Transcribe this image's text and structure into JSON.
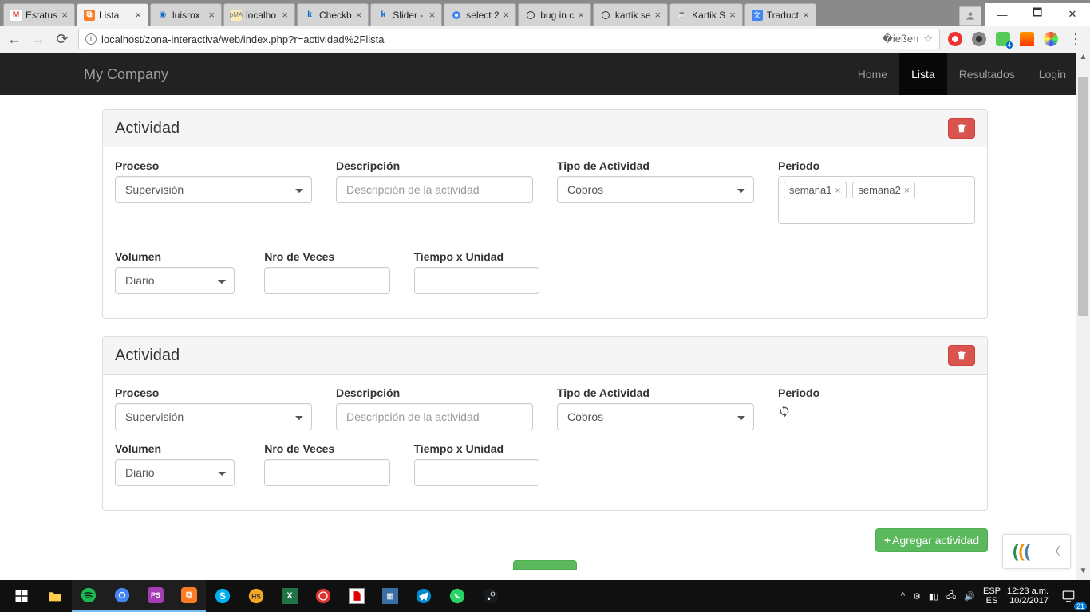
{
  "browser": {
    "tabs": [
      {
        "title": "Estatus",
        "icon_bg": "#fff",
        "icon_text": "M"
      },
      {
        "title": "Lista",
        "icon_bg": "#fb7c24",
        "icon_text": "X",
        "active": true
      },
      {
        "title": "luisrox",
        "icon_bg": "#2f2f2f",
        "icon_text": "◉"
      },
      {
        "title": "localho",
        "icon_bg": "#fceab7",
        "icon_text": "p"
      },
      {
        "title": "Checkb",
        "icon_bg": "#fff",
        "icon_text": "k"
      },
      {
        "title": "Slider -",
        "icon_bg": "#fff",
        "icon_text": "k"
      },
      {
        "title": "select 2",
        "icon_bg": "#fff",
        "icon_text": "G"
      },
      {
        "title": "bug in c",
        "icon_bg": "#fff",
        "icon_text": "○"
      },
      {
        "title": "kartik se",
        "icon_bg": "#fff",
        "icon_text": "○"
      },
      {
        "title": "Kartik S",
        "icon_bg": "#fff",
        "icon_text": "☕"
      },
      {
        "title": "Traduct",
        "icon_bg": "#4285f4",
        "icon_text": "G"
      }
    ],
    "url": "localhost/zona-interactiva/web/index.php?r=actividad%2Flista"
  },
  "navbar": {
    "brand": "My Company",
    "links": [
      "Home",
      "Lista",
      "Resultados",
      "Login"
    ],
    "active": "Lista"
  },
  "panels": [
    {
      "title": "Actividad",
      "fields": {
        "proceso_label": "Proceso",
        "proceso_value": "Supervisión",
        "descripcion_label": "Descripción",
        "descripcion_placeholder": "Descripción de la actividad",
        "tipo_label": "Tipo de Actividad",
        "tipo_value": "Cobros",
        "periodo_label": "Periodo",
        "periodo_tags": [
          "semana1",
          "semana2"
        ],
        "volumen_label": "Volumen",
        "volumen_value": "Diario",
        "nro_label": "Nro de Veces",
        "tiempo_label": "Tiempo x Unidad"
      },
      "periodo_mode": "tags"
    },
    {
      "title": "Actividad",
      "fields": {
        "proceso_label": "Proceso",
        "proceso_value": "Supervisión",
        "descripcion_label": "Descripción",
        "descripcion_placeholder": "Descripción de la actividad",
        "tipo_label": "Tipo de Actividad",
        "tipo_value": "Cobros",
        "periodo_label": "Periodo",
        "volumen_label": "Volumen",
        "volumen_value": "Diario",
        "nro_label": "Nro de Veces",
        "tiempo_label": "Tiempo x Unidad"
      },
      "periodo_mode": "loading"
    }
  ],
  "add_button": "Agregar actividad",
  "taskbar": {
    "lang1": "ESP",
    "lang2": "ES",
    "time": "12:23 a.m.",
    "date": "10/2/2017"
  }
}
